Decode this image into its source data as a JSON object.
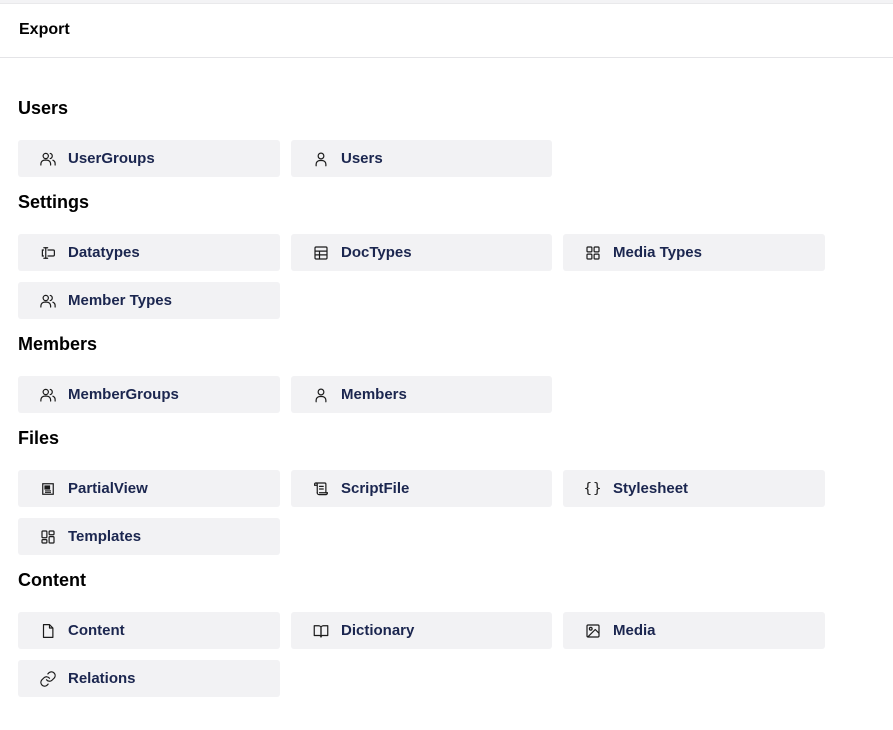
{
  "header": {
    "title": "Export"
  },
  "sections": [
    {
      "title": "Users",
      "items": [
        {
          "label": "UserGroups",
          "icon": "users-icon"
        },
        {
          "label": "Users",
          "icon": "user-icon"
        }
      ]
    },
    {
      "title": "Settings",
      "items": [
        {
          "label": "Datatypes",
          "icon": "datatype-icon"
        },
        {
          "label": "DocTypes",
          "icon": "table-icon"
        },
        {
          "label": "Media Types",
          "icon": "grid-icon"
        },
        {
          "label": "Member Types",
          "icon": "users-icon"
        }
      ]
    },
    {
      "title": "Members",
      "items": [
        {
          "label": "MemberGroups",
          "icon": "users-icon"
        },
        {
          "label": "Members",
          "icon": "user-icon"
        }
      ]
    },
    {
      "title": "Files",
      "items": [
        {
          "label": "PartialView",
          "icon": "newspaper-icon"
        },
        {
          "label": "ScriptFile",
          "icon": "scroll-icon"
        },
        {
          "label": "Stylesheet",
          "icon": "braces-icon"
        },
        {
          "label": "Templates",
          "icon": "layout-icon"
        }
      ]
    },
    {
      "title": "Content",
      "items": [
        {
          "label": "Content",
          "icon": "document-icon"
        },
        {
          "label": "Dictionary",
          "icon": "book-icon"
        },
        {
          "label": "Media",
          "icon": "image-icon"
        },
        {
          "label": "Relations",
          "icon": "link-icon"
        }
      ]
    }
  ]
}
